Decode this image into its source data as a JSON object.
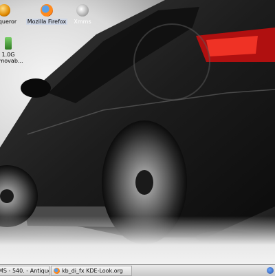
{
  "desktop": {
    "icons": [
      {
        "label": "onqueror"
      },
      {
        "label": "Mozilla Firefox"
      },
      {
        "label": "Xmms"
      },
      {
        "label": "1.0G removab..."
      }
    ],
    "wallpaper": {
      "colors": {
        "background": "#111111",
        "highlight": "#f2f2f2"
      }
    }
  },
  "taskbar": {
    "tasks": [
      {
        "label": "MS - 540. - Antique"
      },
      {
        "label": "kb_di_fx KDE-Look.org"
      }
    ]
  }
}
